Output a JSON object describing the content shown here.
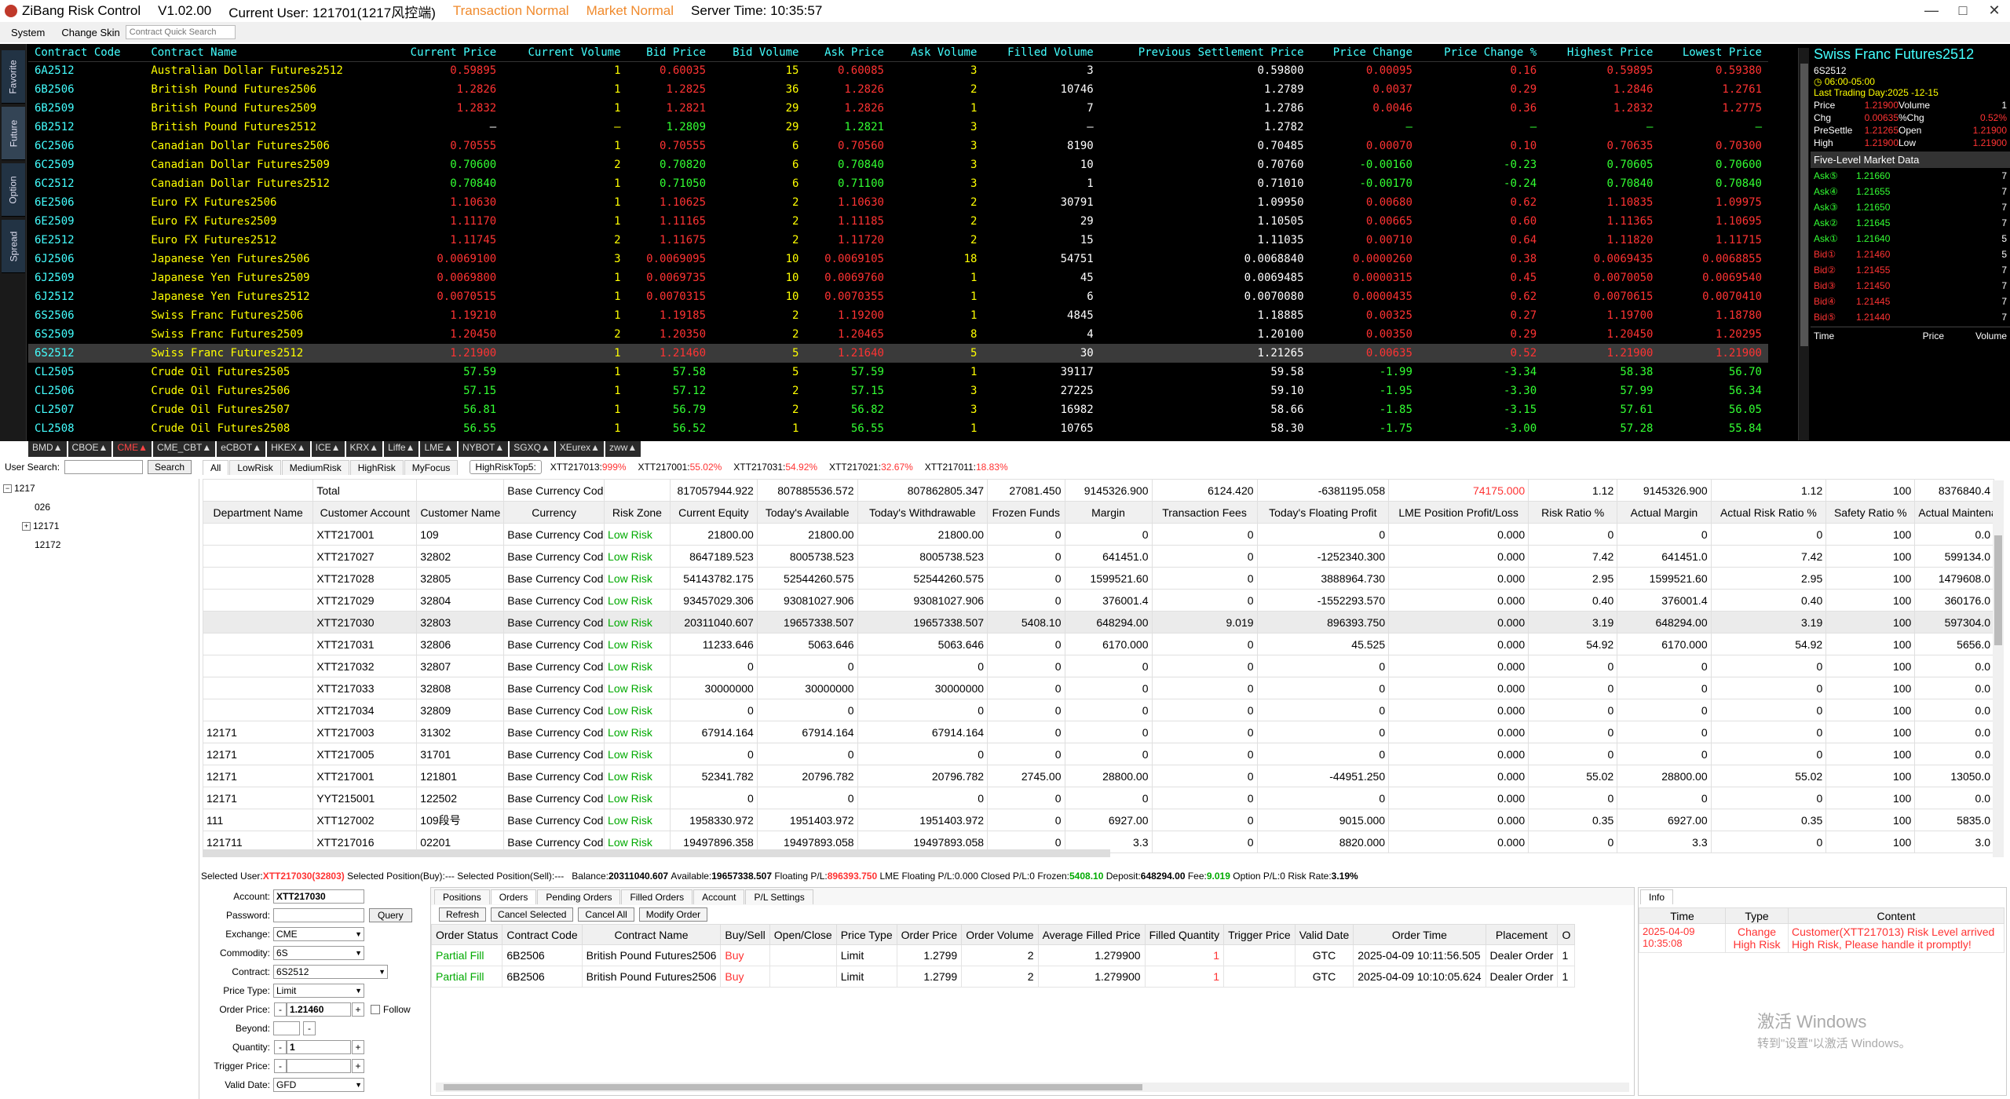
{
  "titlebar": {
    "app": "ZiBang Risk Control",
    "version": "V1.02.00",
    "user": "Current User: 121701(1217风控端)",
    "trans_status": "Transaction Normal",
    "market_status": "Market Normal",
    "server_time": "Server Time: 10:35:57",
    "minimize": "—",
    "maximize": "□",
    "close": "✕"
  },
  "menu": {
    "system": "System",
    "skin": "Change Skin",
    "quick_search": "Contract Quick Search"
  },
  "vtabs": [
    "Favorite",
    "Future",
    "Option",
    "Spread"
  ],
  "quote_headers": [
    "Contract Code",
    "Contract Name",
    "Current Price",
    "Current Volume",
    "Bid Price",
    "Bid Volume",
    "Ask Price",
    "Ask Volume",
    "Filled Volume",
    "Previous Settlement Price",
    "Price Change",
    "Price Change %",
    "Highest Price",
    "Lowest Price"
  ],
  "quotes": [
    [
      "6A2512",
      "Australian Dollar Futures2512",
      "0.59895",
      "1",
      "0.60035",
      "15",
      "0.60085",
      "3",
      "3",
      "0.59800",
      "0.00095",
      "0.16",
      "0.59895",
      "0.59380"
    ],
    [
      "6B2506",
      "British Pound Futures2506",
      "1.2826",
      "1",
      "1.2825",
      "36",
      "1.2826",
      "2",
      "10746",
      "1.2789",
      "0.0037",
      "0.29",
      "1.2846",
      "1.2761"
    ],
    [
      "6B2509",
      "British Pound Futures2509",
      "1.2832",
      "1",
      "1.2821",
      "29",
      "1.2826",
      "1",
      "7",
      "1.2786",
      "0.0046",
      "0.36",
      "1.2832",
      "1.2775"
    ],
    [
      "6B2512",
      "British Pound Futures2512",
      "—",
      "—",
      "1.2809",
      "29",
      "1.2821",
      "3",
      "—",
      "1.2782",
      "—",
      "—",
      "—",
      "—"
    ],
    [
      "6C2506",
      "Canadian Dollar Futures2506",
      "0.70555",
      "1",
      "0.70555",
      "6",
      "0.70560",
      "3",
      "8190",
      "0.70485",
      "0.00070",
      "0.10",
      "0.70635",
      "0.70300"
    ],
    [
      "6C2509",
      "Canadian Dollar Futures2509",
      "0.70600",
      "2",
      "0.70820",
      "6",
      "0.70840",
      "3",
      "10",
      "0.70760",
      "-0.00160",
      "-0.23",
      "0.70605",
      "0.70600"
    ],
    [
      "6C2512",
      "Canadian Dollar Futures2512",
      "0.70840",
      "1",
      "0.71050",
      "6",
      "0.71100",
      "3",
      "1",
      "0.71010",
      "-0.00170",
      "-0.24",
      "0.70840",
      "0.70840"
    ],
    [
      "6E2506",
      "Euro FX Futures2506",
      "1.10630",
      "1",
      "1.10625",
      "2",
      "1.10630",
      "2",
      "30791",
      "1.09950",
      "0.00680",
      "0.62",
      "1.10835",
      "1.09975"
    ],
    [
      "6E2509",
      "Euro FX Futures2509",
      "1.11170",
      "1",
      "1.11165",
      "2",
      "1.11185",
      "2",
      "29",
      "1.10505",
      "0.00665",
      "0.60",
      "1.11365",
      "1.10695"
    ],
    [
      "6E2512",
      "Euro FX Futures2512",
      "1.11745",
      "2",
      "1.11675",
      "2",
      "1.11720",
      "2",
      "15",
      "1.11035",
      "0.00710",
      "0.64",
      "1.11820",
      "1.11715"
    ],
    [
      "6J2506",
      "Japanese Yen Futures2506",
      "0.0069100",
      "3",
      "0.0069095",
      "10",
      "0.0069105",
      "18",
      "54751",
      "0.0068840",
      "0.0000260",
      "0.38",
      "0.0069435",
      "0.0068855"
    ],
    [
      "6J2509",
      "Japanese Yen Futures2509",
      "0.0069800",
      "1",
      "0.0069735",
      "10",
      "0.0069760",
      "1",
      "45",
      "0.0069485",
      "0.0000315",
      "0.45",
      "0.0070050",
      "0.0069540"
    ],
    [
      "6J2512",
      "Japanese Yen Futures2512",
      "0.0070515",
      "1",
      "0.0070315",
      "10",
      "0.0070355",
      "1",
      "6",
      "0.0070080",
      "0.0000435",
      "0.62",
      "0.0070615",
      "0.0070410"
    ],
    [
      "6S2506",
      "Swiss Franc Futures2506",
      "1.19210",
      "1",
      "1.19185",
      "2",
      "1.19200",
      "1",
      "4845",
      "1.18885",
      "0.00325",
      "0.27",
      "1.19700",
      "1.18780"
    ],
    [
      "6S2509",
      "Swiss Franc Futures2509",
      "1.20450",
      "2",
      "1.20350",
      "2",
      "1.20465",
      "8",
      "4",
      "1.20100",
      "0.00350",
      "0.29",
      "1.20450",
      "1.20295"
    ],
    [
      "6S2512",
      "Swiss Franc Futures2512",
      "1.21900",
      "1",
      "1.21460",
      "5",
      "1.21640",
      "5",
      "30",
      "1.21265",
      "0.00635",
      "0.52",
      "1.21900",
      "1.21900"
    ],
    [
      "CL2505",
      "Crude Oil Futures2505",
      "57.59",
      "1",
      "57.58",
      "5",
      "57.59",
      "1",
      "39117",
      "59.58",
      "-1.99",
      "-3.34",
      "58.38",
      "56.70"
    ],
    [
      "CL2506",
      "Crude Oil Futures2506",
      "57.15",
      "1",
      "57.12",
      "2",
      "57.15",
      "3",
      "27225",
      "59.10",
      "-1.95",
      "-3.30",
      "57.99",
      "56.34"
    ],
    [
      "CL2507",
      "Crude Oil Futures2507",
      "56.81",
      "1",
      "56.79",
      "2",
      "56.82",
      "3",
      "16982",
      "58.66",
      "-1.85",
      "-3.15",
      "57.61",
      "56.05"
    ],
    [
      "CL2508",
      "Crude Oil Futures2508",
      "56.55",
      "1",
      "56.52",
      "1",
      "56.55",
      "1",
      "10765",
      "58.30",
      "-1.75",
      "-3.00",
      "57.28",
      "55.84"
    ]
  ],
  "exchanges": [
    "BMD▲",
    "CBOE▲",
    "CME▲",
    "CME_CBT▲",
    "eCBOT▲",
    "HKEX▲",
    "ICE▲",
    "KRX▲",
    "Liffe▲",
    "LME▲",
    "NYBOT▲",
    "SGXQ▲",
    "XEurex▲",
    "zww▲"
  ],
  "detail": {
    "title": "Swiss Franc Futures2512",
    "code": "6S2512",
    "session": "06:00-05:00",
    "last_day": "Last Trading Day:2025 -12-15",
    "rows": [
      [
        "Price",
        "1.21900",
        "Volume",
        "1"
      ],
      [
        "Chg",
        "0.00635",
        "%Chg",
        "0.52%"
      ],
      [
        "PreSettle",
        "1.21265",
        "Open",
        "1.21900"
      ],
      [
        "High",
        "1.21900",
        "Low",
        "1.21900"
      ]
    ],
    "five_level": "Five-Level Market Data",
    "asks": [
      [
        "Ask⑤",
        "1.21660",
        "7"
      ],
      [
        "Ask④",
        "1.21655",
        "7"
      ],
      [
        "Ask③",
        "1.21650",
        "7"
      ],
      [
        "Ask②",
        "1.21645",
        "7"
      ],
      [
        "Ask①",
        "1.21640",
        "5"
      ]
    ],
    "bids": [
      [
        "Bid①",
        "1.21460",
        "5"
      ],
      [
        "Bid②",
        "1.21455",
        "7"
      ],
      [
        "Bid③",
        "1.21450",
        "7"
      ],
      [
        "Bid④",
        "1.21445",
        "7"
      ],
      [
        "Bid⑤",
        "1.21440",
        "7"
      ]
    ],
    "tv_headers": [
      "Time",
      "Price",
      "Volume"
    ]
  },
  "search": {
    "label": "User Search:",
    "button": "Search"
  },
  "tree": [
    "1217",
    "026",
    "12171",
    "12172"
  ],
  "risk_tabs": [
    "All",
    "LowRisk",
    "MediumRisk",
    "HighRisk",
    "MyFocus"
  ],
  "top5": {
    "label": "HighRiskTop5:",
    "items": [
      [
        "XTT217013:",
        "999%"
      ],
      [
        "XTT217001:",
        "55.02%"
      ],
      [
        "XTT217031:",
        "54.92%"
      ],
      [
        "XTT217021:",
        "32.67%"
      ],
      [
        "XTT217011:",
        "18.83%"
      ]
    ]
  },
  "acct_total": [
    "",
    "Total",
    "",
    "Base Currency Code",
    "",
    "817057944.922",
    "807885536.572",
    "807862805.347",
    "27081.450",
    "9145326.900",
    "6124.420",
    "-6381195.058",
    "74175.000",
    "1.12",
    "9145326.900",
    "1.12",
    "100",
    "8376840.4"
  ],
  "acct_headers": [
    "Department Name",
    "Customer Account",
    "Customer Name",
    "Currency",
    "Risk Zone",
    "Current Equity",
    "Today's Available",
    "Today's Withdrawable",
    "Frozen Funds",
    "Margin",
    "Transaction Fees",
    "Today's Floating Profit",
    "LME Position Profit/Loss",
    "Risk Ratio %",
    "Actual Margin",
    "Actual Risk Ratio %",
    "Safety Ratio %",
    "Actual Maintenance Mar"
  ],
  "accounts": [
    [
      "",
      "XTT217001",
      "109",
      "Base Currency Code",
      "Low Risk",
      "21800.00",
      "21800.00",
      "21800.00",
      "0",
      "0",
      "0",
      "0",
      "0.000",
      "0",
      "0",
      "0",
      "100",
      "0.0"
    ],
    [
      "",
      "XTT217027",
      "32802",
      "Base Currency Code",
      "Low Risk",
      "8647189.523",
      "8005738.523",
      "8005738.523",
      "0",
      "641451.0",
      "0",
      "-1252340.300",
      "0.000",
      "7.42",
      "641451.0",
      "7.42",
      "100",
      "599134.0"
    ],
    [
      "",
      "XTT217028",
      "32805",
      "Base Currency Code",
      "Low Risk",
      "54143782.175",
      "52544260.575",
      "52544260.575",
      "0",
      "1599521.60",
      "0",
      "3888964.730",
      "0.000",
      "2.95",
      "1599521.60",
      "2.95",
      "100",
      "1479608.0"
    ],
    [
      "",
      "XTT217029",
      "32804",
      "Base Currency Code",
      "Low Risk",
      "93457029.306",
      "93081027.906",
      "93081027.906",
      "0",
      "376001.4",
      "0",
      "-1552293.570",
      "0.000",
      "0.40",
      "376001.4",
      "0.40",
      "100",
      "360176.0"
    ],
    [
      "",
      "XTT217030",
      "32803",
      "Base Currency Code",
      "Low Risk",
      "20311040.607",
      "19657338.507",
      "19657338.507",
      "5408.10",
      "648294.00",
      "9.019",
      "896393.750",
      "0.000",
      "3.19",
      "648294.00",
      "3.19",
      "100",
      "597304.0"
    ],
    [
      "",
      "XTT217031",
      "32806",
      "Base Currency Code",
      "Low Risk",
      "11233.646",
      "5063.646",
      "5063.646",
      "0",
      "6170.000",
      "0",
      "45.525",
      "0.000",
      "54.92",
      "6170.000",
      "54.92",
      "100",
      "5656.0"
    ],
    [
      "",
      "XTT217032",
      "32807",
      "Base Currency Code",
      "Low Risk",
      "0",
      "0",
      "0",
      "0",
      "0",
      "0",
      "0",
      "0.000",
      "0",
      "0",
      "0",
      "100",
      "0.0"
    ],
    [
      "",
      "XTT217033",
      "32808",
      "Base Currency Code",
      "Low Risk",
      "30000000",
      "30000000",
      "30000000",
      "0",
      "0",
      "0",
      "0",
      "0.000",
      "0",
      "0",
      "0",
      "100",
      "0.0"
    ],
    [
      "",
      "XTT217034",
      "32809",
      "Base Currency Code",
      "Low Risk",
      "0",
      "0",
      "0",
      "0",
      "0",
      "0",
      "0",
      "0.000",
      "0",
      "0",
      "0",
      "100",
      "0.0"
    ],
    [
      "12171",
      "XTT217003",
      "31302",
      "Base Currency Code",
      "Low Risk",
      "67914.164",
      "67914.164",
      "67914.164",
      "0",
      "0",
      "0",
      "0",
      "0.000",
      "0",
      "0",
      "0",
      "100",
      "0.0"
    ],
    [
      "12171",
      "XTT217005",
      "31701",
      "Base Currency Code",
      "Low Risk",
      "0",
      "0",
      "0",
      "0",
      "0",
      "0",
      "0",
      "0.000",
      "0",
      "0",
      "0",
      "100",
      "0.0"
    ],
    [
      "12171",
      "XTT217001",
      "121801",
      "Base Currency Code",
      "Low Risk",
      "52341.782",
      "20796.782",
      "20796.782",
      "2745.00",
      "28800.00",
      "0",
      "-44951.250",
      "0.000",
      "55.02",
      "28800.00",
      "55.02",
      "100",
      "13050.0"
    ],
    [
      "12171",
      "YYT215001",
      "122502",
      "Base Currency Code",
      "Low Risk",
      "0",
      "0",
      "0",
      "0",
      "0",
      "0",
      "0",
      "0.000",
      "0",
      "0",
      "0",
      "100",
      "0.0"
    ],
    [
      "111",
      "XTT127002",
      "109段号",
      "Base Currency Code",
      "Low Risk",
      "1958330.972",
      "1951403.972",
      "1951403.972",
      "0",
      "6927.00",
      "0",
      "9015.000",
      "0.000",
      "0.35",
      "6927.00",
      "0.35",
      "100",
      "5835.0"
    ],
    [
      "121711",
      "XTT217016",
      "02201",
      "Base Currency Code",
      "Low Risk",
      "19497896.358",
      "19497893.058",
      "19497893.058",
      "0",
      "3.3",
      "0",
      "8820.000",
      "0.000",
      "0",
      "3.3",
      "0",
      "100",
      "3.0"
    ]
  ],
  "status": {
    "sel_user_label": "Selected User:",
    "sel_user": "XTT217030(32803)",
    "buy_label": "Selected Position(Buy):",
    "buy": "---",
    "sell_label": "Selected Position(Sell):",
    "sell": "---",
    "balance_label": "Balance:",
    "balance": "20311040.607",
    "avail_label": "Available:",
    "avail": "19657338.507",
    "fpl_label": "Floating P/L:",
    "fpl": "896393.750",
    "lme_label": "LME Floating P/L:",
    "lme": "0.000",
    "cpl_label": "Closed P/L:",
    "cpl": "0",
    "frozen_label": "Frozen:",
    "frozen": "5408.10",
    "deposit_label": "Deposit:",
    "deposit": "648294.00",
    "fee_label": "Fee:",
    "fee": "9.019",
    "opt_label": "Option P/L:",
    "opt": "0",
    "rr_label": "Risk Rate:",
    "rr": "3.19%"
  },
  "form": {
    "account_label": "Account:",
    "account": "XTT217030",
    "password_label": "Password:",
    "query": "Query",
    "exchange_label": "Exchange:",
    "exchange": "CME",
    "commodity_label": "Commodity:",
    "commodity": "6S",
    "contract_label": "Contract:",
    "contract": "6S2512",
    "ptype_label": "Price Type:",
    "ptype": "Limit",
    "oprice_label": "Order Price:",
    "oprice": "1.21460",
    "follow": "Follow",
    "beyond_label": "Beyond:",
    "beyond": "",
    "qty_label": "Quantity:",
    "qty": "1",
    "trig_label": "Trigger Price:",
    "trig": "",
    "valid_label": "Valid Date:",
    "valid": "GFD",
    "minus": "-",
    "plus": "+"
  },
  "order_tabs": [
    "Positions",
    "Orders",
    "Pending Orders",
    "Filled Orders",
    "Account",
    "P/L Settings"
  ],
  "order_btns": [
    "Refresh",
    "Cancel Selected",
    "Cancel All",
    "Modify Order"
  ],
  "order_headers": [
    "Order Status",
    "Contract Code",
    "Contract Name",
    "Buy/Sell",
    "Open/Close",
    "Price Type",
    "Order Price",
    "Order Volume",
    "Average Filled Price",
    "Filled Quantity",
    "Trigger Price",
    "Valid Date",
    "Order Time",
    "Placement",
    "O"
  ],
  "orders": [
    [
      "Partial Fill",
      "6B2506",
      "British Pound Futures2506",
      "Buy",
      "",
      "Limit",
      "1.2799",
      "2",
      "1.279900",
      "1",
      "",
      "GTC",
      "2025-04-09 10:11:56.505",
      "Dealer Order",
      "1"
    ],
    [
      "Partial Fill",
      "6B2506",
      "British Pound Futures2506",
      "Buy",
      "",
      "Limit",
      "1.2799",
      "2",
      "1.279900",
      "1",
      "",
      "GTC",
      "2025-04-09 10:10:05.624",
      "Dealer Order",
      "1"
    ]
  ],
  "info": {
    "tab": "Info",
    "headers": [
      "Time",
      "Type",
      "Content"
    ],
    "row": [
      "2025-04-09 10:35:08",
      "Change High Risk",
      "Customer(XTT217013) Risk Level arrived High Risk, Please handle it promptly!"
    ]
  },
  "watermark": {
    "line1": "激活 Windows",
    "line2": "转到\"设置\"以激活 Windows。"
  },
  "colors": {
    "cyan": "#44ffff",
    "yellow": "#ffff00",
    "red": "#ff3333",
    "green": "#33ff33",
    "orange": "#f08a2c"
  }
}
